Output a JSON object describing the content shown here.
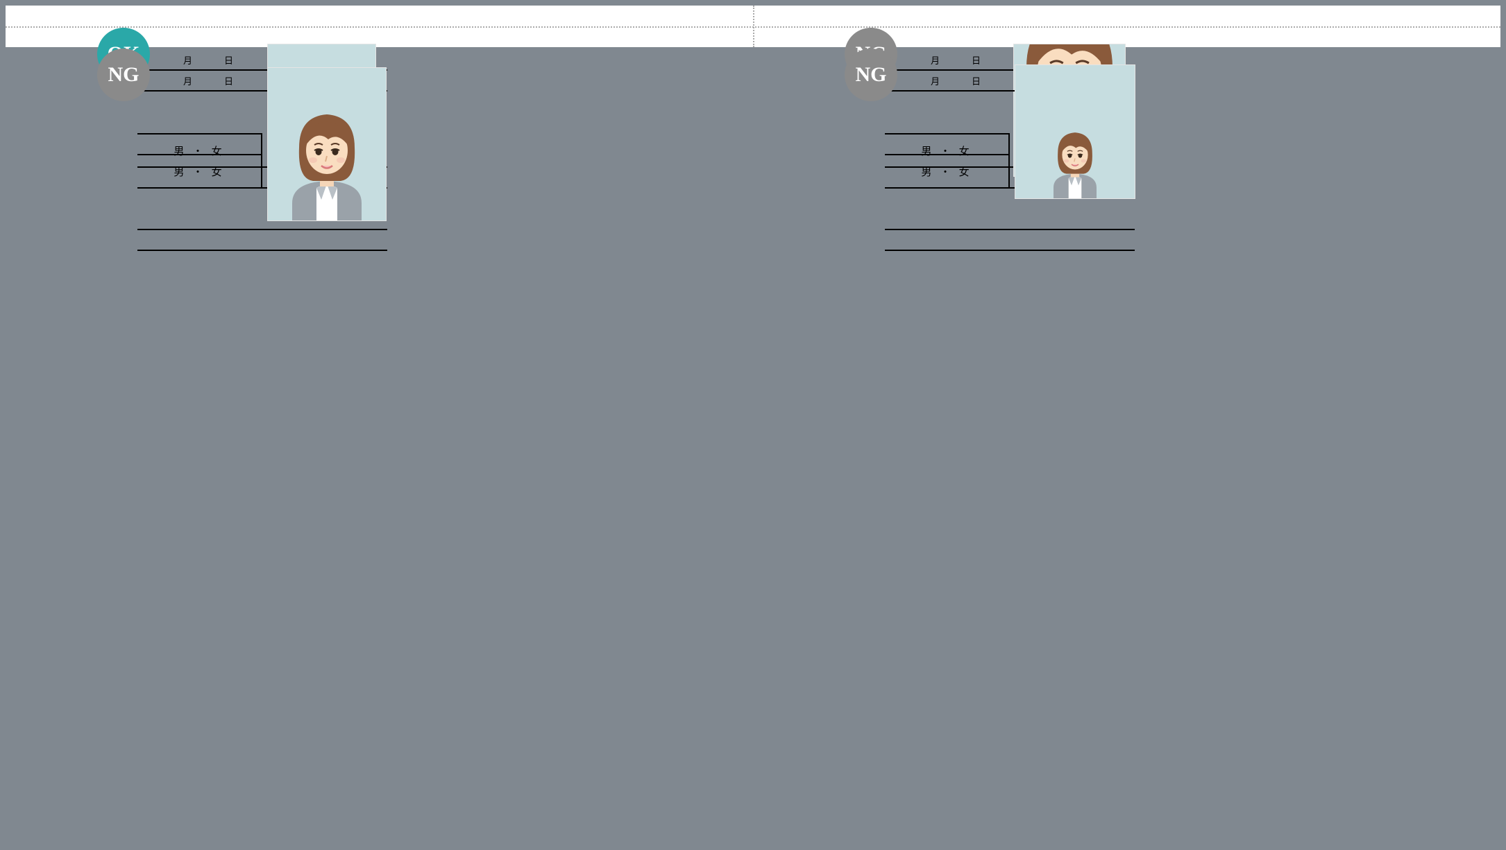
{
  "panels": [
    {
      "badge": "OK",
      "badgeType": "ok",
      "dotted": true,
      "photoStyle": "normal",
      "month": "月",
      "day": "日",
      "gender": "男  ・  女"
    },
    {
      "badge": "NG",
      "badgeType": "ng",
      "dotted": true,
      "photoStyle": "too_close",
      "month": "月",
      "day": "日",
      "gender": "男  ・  女"
    },
    {
      "badge": "NG",
      "badgeType": "ng",
      "dotted": false,
      "photoStyle": "off_frame",
      "month": "月",
      "day": "日",
      "gender": "男  ・  女"
    },
    {
      "badge": "NG",
      "badgeType": "ng",
      "dotted": false,
      "photoStyle": "too_small",
      "month": "月",
      "day": "日",
      "gender": "男  ・  女"
    }
  ],
  "colors": {
    "ok_badge": "#2aa8a8",
    "ng_badge": "#8a8a8a",
    "photo_bg": "#c6dde0"
  }
}
